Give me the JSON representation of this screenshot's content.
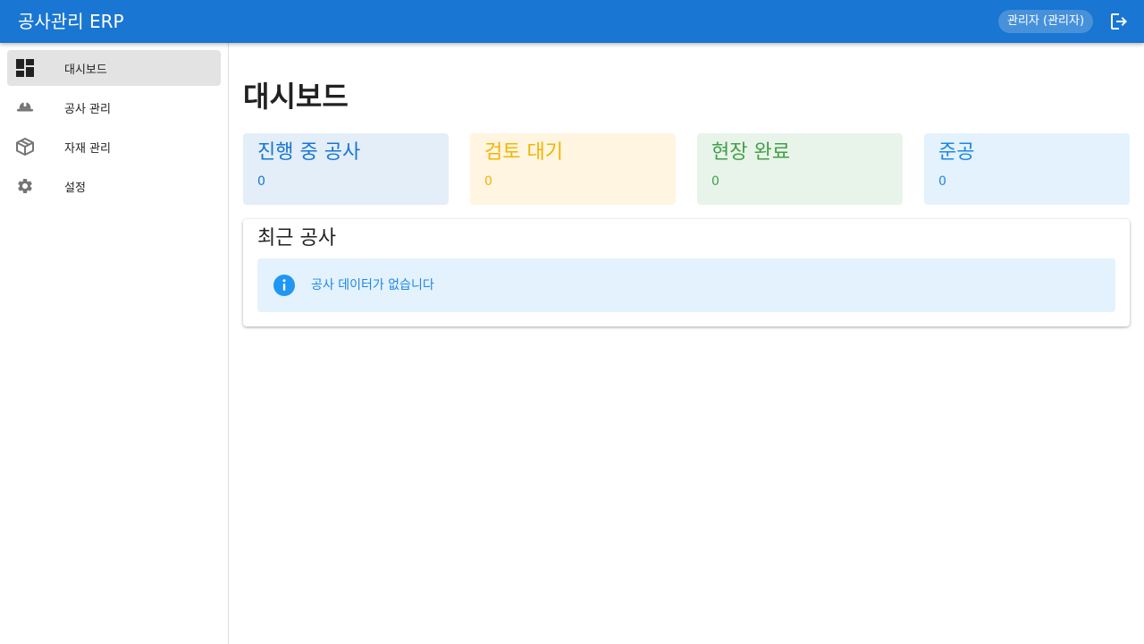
{
  "app": {
    "title": "공사관리 ERP",
    "user_chip": "관리자 (관리자)",
    "logout_icon": "logout-icon"
  },
  "sidebar": {
    "items": [
      {
        "label": "대시보드",
        "icon": "dashboard-icon",
        "active": true
      },
      {
        "label": "공사 관리",
        "icon": "hardhat-icon",
        "active": false
      },
      {
        "label": "자재 관리",
        "icon": "package-icon",
        "active": false
      },
      {
        "label": "설정",
        "icon": "gear-icon",
        "active": false
      }
    ]
  },
  "main": {
    "page_title": "대시보드",
    "stats": [
      {
        "title": "진행 중 공사",
        "value": "0",
        "text_color": "#1976d2",
        "bg_color": "#e3eef9"
      },
      {
        "title": "검토 대기",
        "value": "0",
        "text_color": "#f4b400",
        "bg_color": "#fff5e0"
      },
      {
        "title": "현장 완료",
        "value": "0",
        "text_color": "#43a047",
        "bg_color": "#e8f4ea"
      },
      {
        "title": "준공",
        "value": "0",
        "text_color": "#1e88e5",
        "bg_color": "#e3f2fd"
      }
    ],
    "recent": {
      "title": "최근 공사",
      "empty_message": "공사 데이터가 없습니다",
      "info_icon": "info-icon"
    }
  },
  "colors": {
    "primary": "#1976d2",
    "alert_bg": "#e3f2fd",
    "alert_text": "#1e88e5"
  }
}
